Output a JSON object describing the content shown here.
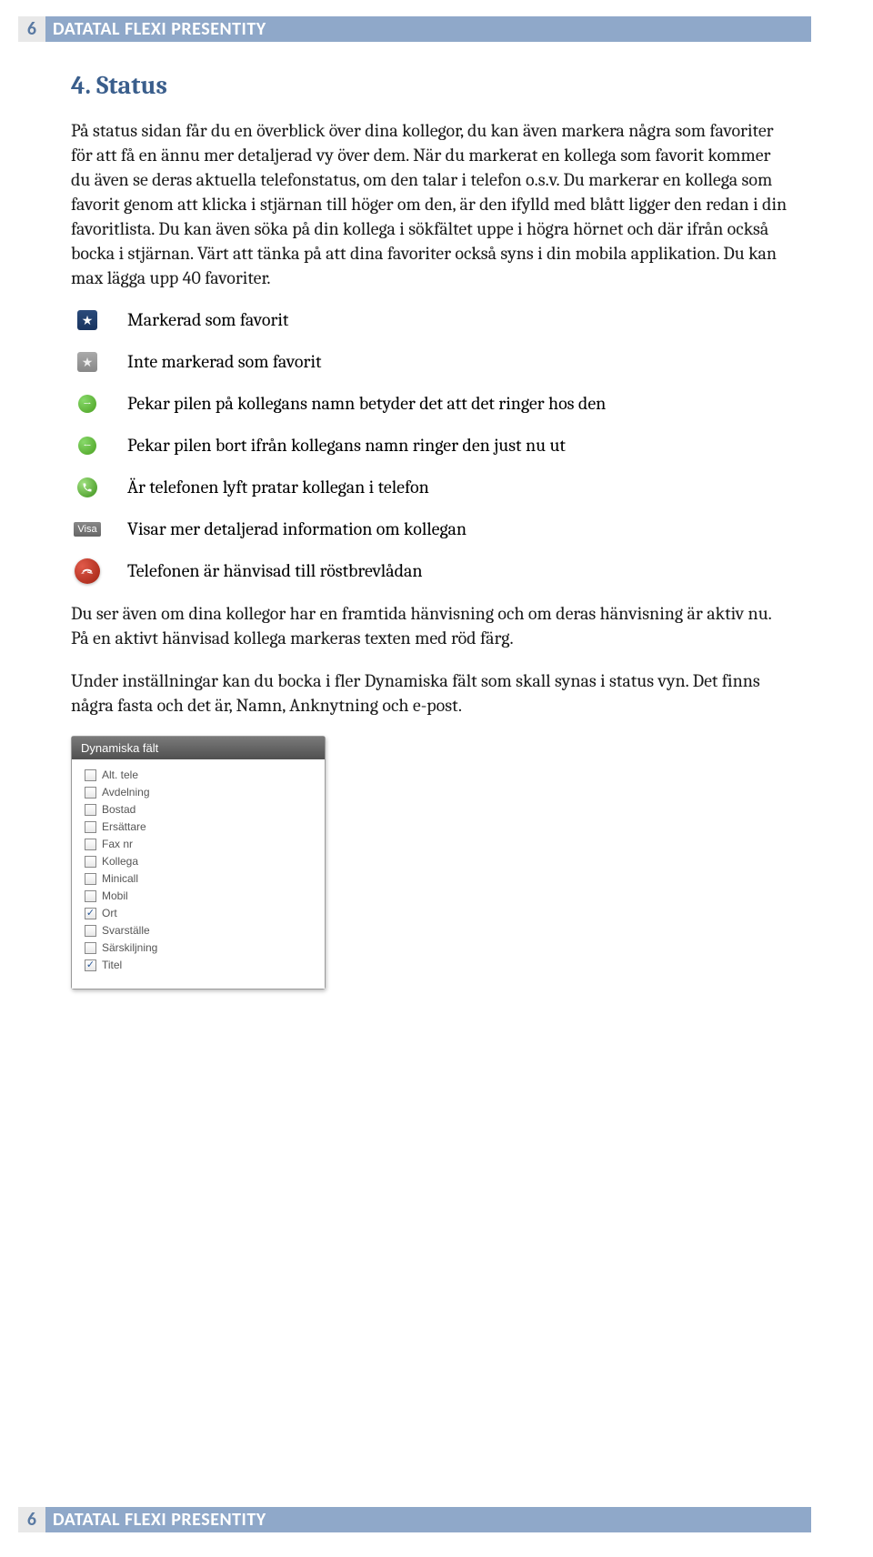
{
  "header": {
    "page": "6",
    "title": "DATATAL FLEXI PRESENTITY"
  },
  "section": {
    "heading": "4.  Status",
    "para1": "På status sidan får du en överblick över dina kollegor, du kan även markera några som favoriter för att få en ännu mer detaljerad vy över dem. När du markerat en kollega som favorit kommer du även se deras aktuella telefonstatus, om den talar i telefon o.s.v. Du markerar en kollega som favorit genom att klicka i stjärnan till höger om den, är den ifylld med blått ligger den redan i din favoritlista. Du kan även söka på din kollega i sökfältet uppe i högra hörnet och där ifrån också bocka i stjärnan. Värt att tänka på att dina favoriter också syns i din mobila applikation. Du kan max lägga upp 40 favoriter.",
    "icons": [
      {
        "label": "Markerad som favorit"
      },
      {
        "label": "Inte markerad som favorit"
      },
      {
        "label": "Pekar pilen på kollegans namn betyder det att det ringer hos den"
      },
      {
        "label": "Pekar pilen bort ifrån kollegans namn ringer den just nu ut"
      },
      {
        "label": "Är telefonen lyft pratar kollegan i telefon"
      },
      {
        "label": "Visar mer detaljerad information om kollegan"
      },
      {
        "label": "Telefonen är hänvisad till röstbrevlådan"
      }
    ],
    "para2": "Du ser även om dina kollegor har en framtida hänvisning och om deras hänvisning är aktiv nu. På en aktivt hänvisad kollega markeras texten med röd färg.",
    "para3": "Under inställningar kan du bocka i fler Dynamiska fält som skall synas i status vyn. Det finns några fasta och det är, Namn, Anknytning och e-post."
  },
  "panel": {
    "title": "Dynamiska fält",
    "items": [
      {
        "label": "Alt. tele",
        "checked": false
      },
      {
        "label": "Avdelning",
        "checked": false
      },
      {
        "label": "Bostad",
        "checked": false
      },
      {
        "label": "Ersättare",
        "checked": false
      },
      {
        "label": "Fax nr",
        "checked": false
      },
      {
        "label": "Kollega",
        "checked": false
      },
      {
        "label": "Minicall",
        "checked": false
      },
      {
        "label": "Mobil",
        "checked": false
      },
      {
        "label": "Ort",
        "checked": true
      },
      {
        "label": "Svarställe",
        "checked": false
      },
      {
        "label": "Särskiljning",
        "checked": false
      },
      {
        "label": "Titel",
        "checked": true
      }
    ]
  },
  "footer": {
    "page": "6",
    "title": "DATATAL FLEXI PRESENTITY"
  },
  "visa_label": "Visa"
}
